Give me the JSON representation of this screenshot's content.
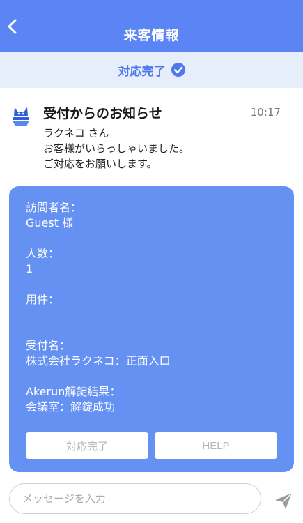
{
  "header": {
    "title": "来客情報"
  },
  "status": {
    "label": "対応完了"
  },
  "notice": {
    "title": "受付からのお知らせ",
    "time": "10:17",
    "lines": [
      "ラクネコ さん",
      "お客様がいらっしゃいました。",
      "ご対応をお願いします。"
    ]
  },
  "card": {
    "visitor_label": "訪問者名：",
    "visitor_value": "Guest 様",
    "count_label": "人数：",
    "count_value": "1",
    "purpose_label": "用件：",
    "purpose_value": "",
    "reception_label": "受付名：",
    "reception_value": "株式会社ラクネコ：正面入口",
    "lock_label": "Akerun解錠結果：",
    "lock_value": "会議室：解錠成功",
    "buttons": {
      "done": "対応完了",
      "help": "HELP"
    }
  },
  "message": {
    "placeholder": "メッセージを入力",
    "value": ""
  },
  "colors": {
    "primary": "#5b84f5",
    "card": "#6591f3",
    "status_bg": "#e6edfb",
    "status_text": "#4f78ee"
  },
  "icons": {
    "back": "chevron-left-icon",
    "status": "check-circle-icon",
    "notice": "cat-logo-icon",
    "send": "paper-plane-icon"
  }
}
